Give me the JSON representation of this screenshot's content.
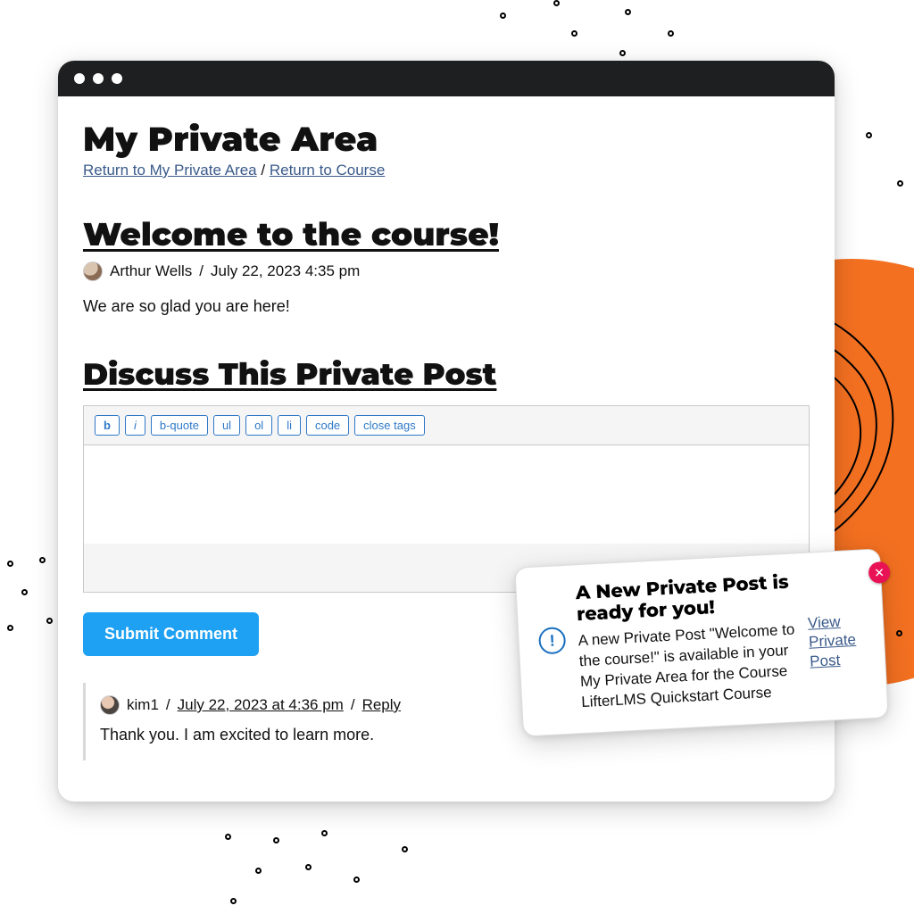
{
  "page": {
    "title": "My Private Area"
  },
  "breadcrumbs": {
    "return_area": "Return to My Private Area",
    "sep": "/",
    "return_course": "Return to Course"
  },
  "post": {
    "title": "Welcome to the course!",
    "author": "Arthur Wells",
    "meta_sep": "/",
    "datetime": "July 22, 2023 4:35 pm",
    "body": "We are so glad you are here!"
  },
  "discuss": {
    "heading": "Discuss This Private Post"
  },
  "editor": {
    "toolbar": [
      "b",
      "i",
      "b-quote",
      "ul",
      "ol",
      "li",
      "code",
      "close tags"
    ],
    "value": ""
  },
  "submit": {
    "label": "Submit Comment"
  },
  "comments": [
    {
      "author": "kim1",
      "sep": "/",
      "datetime": "July 22, 2023 at 4:36 pm",
      "reply_label": "Reply",
      "body": "Thank you. I am excited to learn more."
    }
  ],
  "notification": {
    "title": "A New Private Post is ready for you!",
    "body": "A new Private Post \"Welcome to the course!\" is available in your My Private Area for the Course LifterLMS Quickstart Course",
    "link_label": "View Private Post",
    "icon_glyph": "!",
    "close_glyph": "✕"
  }
}
